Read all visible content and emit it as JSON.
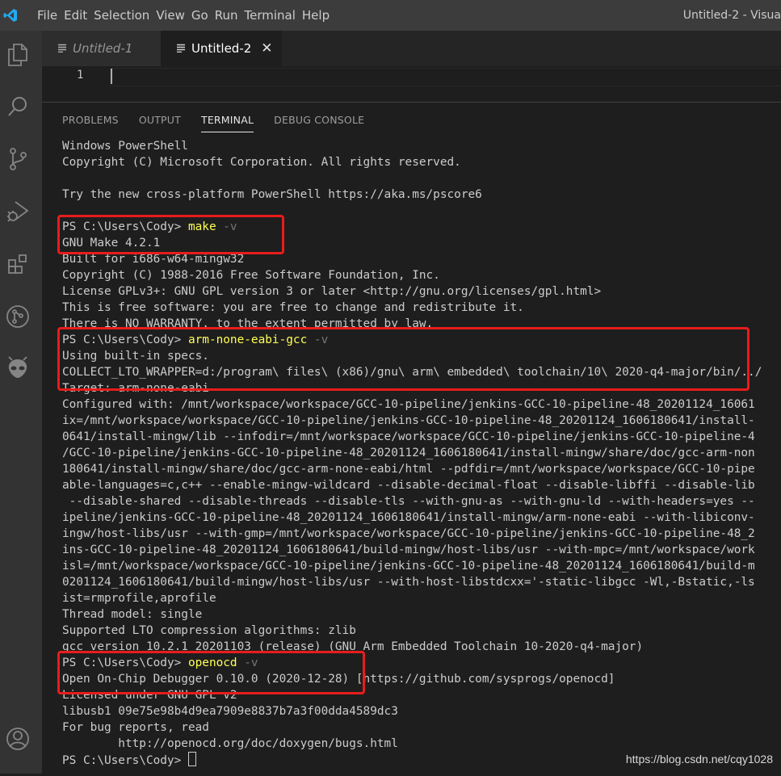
{
  "menubar": {
    "items": [
      "File",
      "Edit",
      "Selection",
      "View",
      "Go",
      "Run",
      "Terminal",
      "Help"
    ],
    "window_title": "Untitled-2 - Visua"
  },
  "activitybar": {
    "icons": [
      "explorer-icon",
      "search-icon",
      "source-control-icon",
      "run-debug-icon",
      "extensions-icon",
      "remote-icon",
      "alien-icon",
      "account-icon"
    ]
  },
  "tabs": [
    {
      "label": "Untitled-1",
      "active": false
    },
    {
      "label": "Untitled-2",
      "active": true
    }
  ],
  "editor": {
    "line_number": "1"
  },
  "panel": {
    "tabs": [
      "PROBLEMS",
      "OUTPUT",
      "TERMINAL",
      "DEBUG CONSOLE"
    ],
    "active_tab": "TERMINAL"
  },
  "terminal": {
    "lines": [
      "Windows PowerShell",
      "Copyright (C) Microsoft Corporation. All rights reserved.",
      "",
      "Try the new cross-platform PowerShell https://aka.ms/pscore6",
      "",
      {
        "prompt": "PS C:\\Users\\Cody> ",
        "cmd": "make",
        "flag": " -v"
      },
      "GNU Make 4.2.1",
      "Built for i686-w64-mingw32",
      "Copyright (C) 1988-2016 Free Software Foundation, Inc.",
      "License GPLv3+: GNU GPL version 3 or later <http://gnu.org/licenses/gpl.html>",
      "This is free software: you are free to change and redistribute it.",
      "There is NO WARRANTY, to the extent permitted by law.",
      {
        "prompt": "PS C:\\Users\\Cody> ",
        "cmd": "arm-none-eabi-gcc",
        "flag": " -v"
      },
      "Using built-in specs.",
      "COLLECT_LTO_WRAPPER=d:/program\\ files\\ (x86)/gnu\\ arm\\ embedded\\ toolchain/10\\ 2020-q4-major/bin/../",
      "Target: arm-none-eabi",
      "Configured with: /mnt/workspace/workspace/GCC-10-pipeline/jenkins-GCC-10-pipeline-48_20201124_16061",
      "ix=/mnt/workspace/workspace/GCC-10-pipeline/jenkins-GCC-10-pipeline-48_20201124_1606180641/install-",
      "0641/install-mingw/lib --infodir=/mnt/workspace/workspace/GCC-10-pipeline/jenkins-GCC-10-pipeline-4",
      "/GCC-10-pipeline/jenkins-GCC-10-pipeline-48_20201124_1606180641/install-mingw/share/doc/gcc-arm-non",
      "180641/install-mingw/share/doc/gcc-arm-none-eabi/html --pdfdir=/mnt/workspace/workspace/GCC-10-pipe",
      "able-languages=c,c++ --enable-mingw-wildcard --disable-decimal-float --disable-libffi --disable-lib",
      " --disable-shared --disable-threads --disable-tls --with-gnu-as --with-gnu-ld --with-headers=yes --",
      "ipeline/jenkins-GCC-10-pipeline-48_20201124_1606180641/install-mingw/arm-none-eabi --with-libiconv-",
      "ingw/host-libs/usr --with-gmp=/mnt/workspace/workspace/GCC-10-pipeline/jenkins-GCC-10-pipeline-48_2",
      "ins-GCC-10-pipeline-48_20201124_1606180641/build-mingw/host-libs/usr --with-mpc=/mnt/workspace/work",
      "isl=/mnt/workspace/workspace/GCC-10-pipeline/jenkins-GCC-10-pipeline-48_20201124_1606180641/build-m",
      "0201124_1606180641/build-mingw/host-libs/usr --with-host-libstdcxx='-static-libgcc -Wl,-Bstatic,-ls",
      "ist=rmprofile,aprofile",
      "Thread model: single",
      "Supported LTO compression algorithms: zlib",
      "gcc version 10.2.1 20201103 (release) (GNU Arm Embedded Toolchain 10-2020-q4-major)",
      {
        "prompt": "PS C:\\Users\\Cody> ",
        "cmd": "openocd",
        "flag": " -v"
      },
      "Open On-Chip Debugger 0.10.0 (2020-12-28) [https://github.com/sysprogs/openocd]",
      "Licensed under GNU GPL v2",
      "libusb1 09e75e98b4d9ea7909e8837b7a3f00dda4589dc3",
      "For bug reports, read",
      "        http://openocd.org/doc/doxygen/bugs.html",
      {
        "prompt": "PS C:\\Users\\Cody> ",
        "cmd": "",
        "flag": "",
        "cursor": true
      }
    ]
  },
  "watermark": "https://blog.csdn.net/cqy1028",
  "colors": {
    "titlebar": "#3c3c3c",
    "activitybar": "#333333",
    "editor_bg": "#1e1e1e",
    "command": "#ffff55",
    "flag": "#767676",
    "annotation_box": "#e81c1c",
    "vscode_blue": "#23a9f2"
  }
}
